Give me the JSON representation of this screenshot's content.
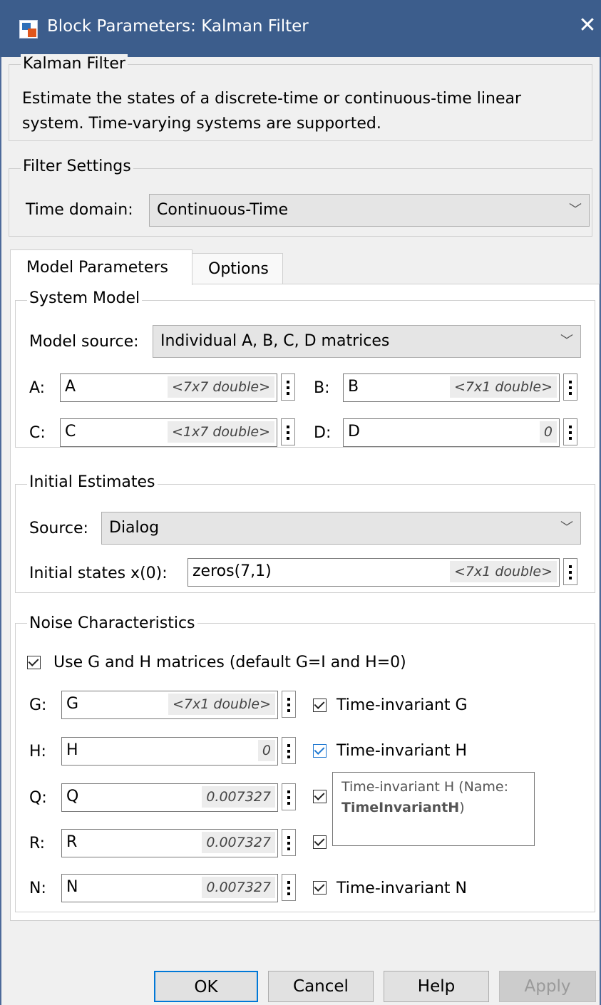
{
  "window": {
    "title": "Block Parameters: Kalman Filter"
  },
  "block": {
    "legend": "Kalman Filter",
    "description": "Estimate the states of a discrete-time or continuous-time linear system. Time-varying systems are supported."
  },
  "filter_settings": {
    "legend": "Filter Settings",
    "time_domain_label": "Time domain:",
    "time_domain_value": "Continuous-Time"
  },
  "tabs": [
    {
      "label": "Model Parameters",
      "active": true
    },
    {
      "label": "Options",
      "active": false
    }
  ],
  "system_model": {
    "legend": "System Model",
    "model_source_label": "Model source:",
    "model_source_value": "Individual A, B, C, D matrices",
    "A": {
      "label": "A:",
      "value": "A",
      "size": "<7x7 double>"
    },
    "B": {
      "label": "B:",
      "value": "B",
      "size": "<7x1 double>"
    },
    "C": {
      "label": "C:",
      "value": "C",
      "size": "<1x7 double>"
    },
    "D": {
      "label": "D:",
      "value": "D",
      "size": "0"
    }
  },
  "initial_estimates": {
    "legend": "Initial Estimates",
    "source_label": "Source:",
    "source_value": "Dialog",
    "x0_label": "Initial states x(0):",
    "x0_value": "zeros(7,1)",
    "x0_size": "<7x1 double>"
  },
  "noise": {
    "legend": "Noise Characteristics",
    "use_gh_label": "Use G and H matrices (default G=I and H=0)",
    "G": {
      "label": "G:",
      "value": "G",
      "size": "<7x1 double>",
      "ti_label": "Time-invariant G"
    },
    "H": {
      "label": "H:",
      "value": "H",
      "size": "0",
      "ti_label": "Time-invariant H"
    },
    "Q": {
      "label": "Q:",
      "value": "Q",
      "size": "0.007327"
    },
    "R": {
      "label": "R:",
      "value": "R",
      "size": "0.007327"
    },
    "N": {
      "label": "N:",
      "value": "N",
      "size": "0.007327",
      "ti_label": "Time-invariant N"
    }
  },
  "tooltip": {
    "line1": "Time-invariant H (Name:",
    "name": "TimeInvariantH",
    "close": ")"
  },
  "buttons": {
    "ok": "OK",
    "cancel": "Cancel",
    "help": "Help",
    "apply": "Apply"
  }
}
